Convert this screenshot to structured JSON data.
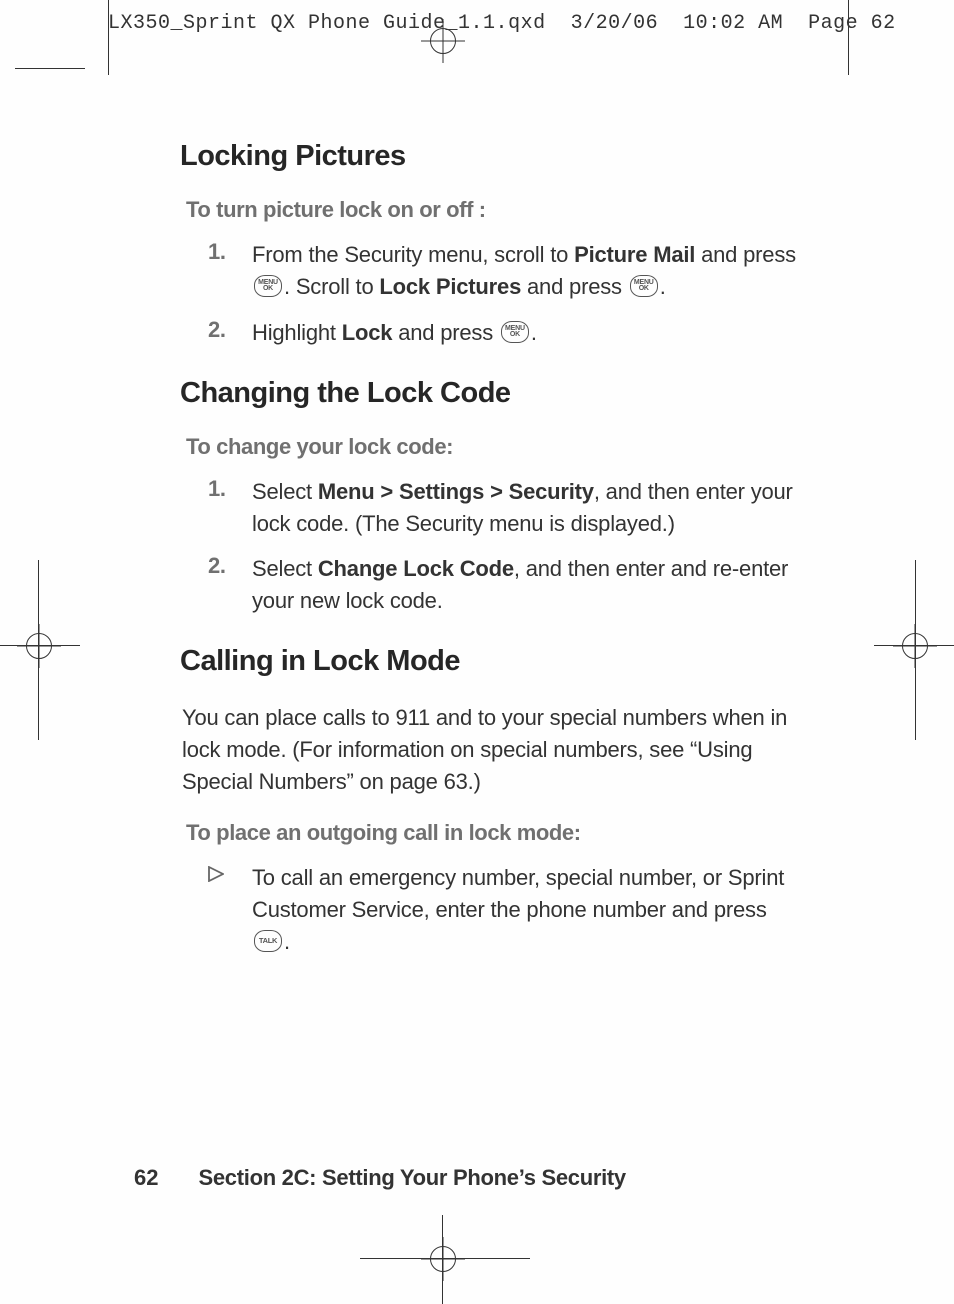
{
  "header": {
    "filename": "LX350_Sprint QX Phone Guide_1.1.qxd",
    "date": "3/20/06",
    "time": "10:02 AM",
    "page_label": "Page 62"
  },
  "sections": {
    "locking_pictures": {
      "heading": "Locking Pictures",
      "sub": "To turn picture lock on or off :",
      "steps": [
        {
          "num": "1.",
          "pre": "From the Security menu, scroll to ",
          "bold1": "Picture Mail",
          "mid1": " and press ",
          "mid2": ". Scroll to ",
          "bold2": "Lock Pictures",
          "mid3": " and press ",
          "end": "."
        },
        {
          "num": "2.",
          "pre": "Highlight ",
          "bold1": "Lock",
          "mid1": " and press ",
          "end": "."
        }
      ]
    },
    "changing_lock_code": {
      "heading": "Changing the Lock Code",
      "sub": "To change your lock code:",
      "steps": [
        {
          "num": "1.",
          "pre": "Select ",
          "bold1": "Menu > Settings > Security",
          "mid1": ", and then enter your lock code. (The Security menu is displayed.)"
        },
        {
          "num": "2.",
          "pre": "Select ",
          "bold1": "Change Lock Code",
          "mid1": ", and then enter and re-enter your new lock code."
        }
      ]
    },
    "calling_lock_mode": {
      "heading": "Calling in Lock Mode",
      "body": "You can place calls to 911 and to your special numbers when in lock mode. (For information on special numbers, see “Using Special Numbers” on page 63.)",
      "sub": "To place an outgoing call in lock mode:",
      "bullet": {
        "pre": "To call an emergency number, special number, or Sprint Customer Service, enter the phone number and press ",
        "end": "."
      }
    }
  },
  "keys": {
    "menu_ok_line1": "MENU",
    "menu_ok_line2": "OK",
    "talk": "TALK"
  },
  "footer": {
    "page_num": "62",
    "title": "Section 2C: Setting Your Phone’s Security"
  }
}
